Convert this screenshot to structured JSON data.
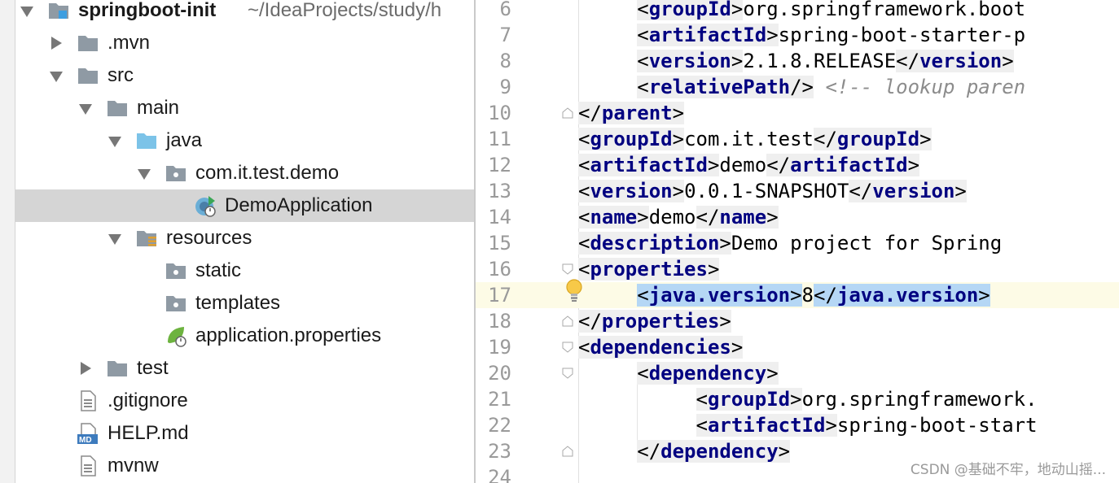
{
  "project_tree": {
    "root": {
      "name": "springboot-init",
      "path": "~/IdeaProjects/study/h"
    },
    "items": [
      {
        "label": ".mvn"
      },
      {
        "label": "src"
      },
      {
        "label": "main"
      },
      {
        "label": "java"
      },
      {
        "label": "com.it.test.demo"
      },
      {
        "label": "DemoApplication"
      },
      {
        "label": "resources"
      },
      {
        "label": "static"
      },
      {
        "label": "templates"
      },
      {
        "label": "application.properties"
      },
      {
        "label": "test"
      },
      {
        "label": ".gitignore"
      },
      {
        "label": "HELP.md"
      },
      {
        "label": "mvnw"
      }
    ],
    "md_badge": "MD"
  },
  "editor": {
    "line_numbers": [
      "6",
      "7",
      "8",
      "9",
      "10",
      "11",
      "12",
      "13",
      "14",
      "15",
      "16",
      "17",
      "18",
      "19",
      "20",
      "21",
      "22",
      "23",
      "24"
    ],
    "lines": [
      {
        "o": "<",
        "tag": "groupId",
        "c": ">",
        "text": "org.springframework.boot"
      },
      {
        "o": "<",
        "tag": "artifactId",
        "c": ">",
        "text": "spring-boot-starter-p"
      },
      {
        "o": "<",
        "tag": "version",
        "c": ">",
        "text": "2.1.8.RELEASE",
        "o2": "</",
        "tag2": "version",
        "c2": ">"
      },
      {
        "o": "<",
        "tag": "relativePath",
        "c": "/>",
        "comment": " <!-- lookup paren"
      },
      {
        "o": "</",
        "tag": "parent",
        "c": ">"
      },
      {
        "o": "<",
        "tag": "groupId",
        "c": ">",
        "text": "com.it.test",
        "o2": "</",
        "tag2": "groupId",
        "c2": ">"
      },
      {
        "o": "<",
        "tag": "artifactId",
        "c": ">",
        "text": "demo",
        "o2": "</",
        "tag2": "artifactId",
        "c2": ">"
      },
      {
        "o": "<",
        "tag": "version",
        "c": ">",
        "text": "0.0.1-SNAPSHOT",
        "o2": "</",
        "tag2": "version",
        "c2": ">"
      },
      {
        "o": "<",
        "tag": "name",
        "c": ">",
        "text": "demo",
        "o2": "</",
        "tag2": "name",
        "c2": ">"
      },
      {
        "o": "<",
        "tag": "description",
        "c": ">",
        "text": "Demo project for Spring"
      },
      {
        "o": "<",
        "tag": "properties",
        "c": ">"
      },
      {
        "o": "<",
        "tag": "java.version",
        "c": ">",
        "text": "8",
        "o2": "</",
        "tag2": "java.version",
        "c2": ">"
      },
      {
        "o": "</",
        "tag": "properties",
        "c": ">"
      },
      {
        "o": "<",
        "tag": "dependencies",
        "c": ">"
      },
      {
        "o": "<",
        "tag": "dependency",
        "c": ">"
      },
      {
        "o": "<",
        "tag": "groupId",
        "c": ">",
        "text": "org.springframework."
      },
      {
        "o": "<",
        "tag": "artifactId",
        "c": ">",
        "text": "spring-boot-start"
      },
      {
        "o": "</",
        "tag": "dependency",
        "c": ">"
      }
    ],
    "current_line": "17"
  },
  "watermark": "CSDN @基础不牢，地动山摇...",
  "colors": {
    "tag": "#000080",
    "selection_row": "#d5d5d5",
    "current_line": "#fdfbe6",
    "folder_grey": "#8f9aa4",
    "folder_blue": "#7cc3e8",
    "spring_green": "#6db33f"
  }
}
